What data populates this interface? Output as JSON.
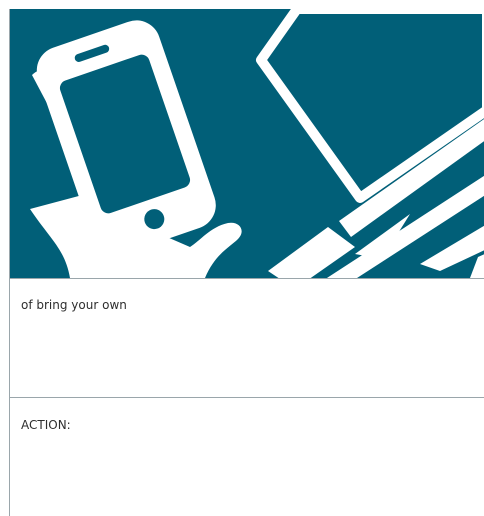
{
  "illustration": {
    "name": "phone-and-laptop",
    "color": "#015f78"
  },
  "section1": {
    "text": "of bring your own"
  },
  "section2": {
    "text": "ACTION:"
  }
}
